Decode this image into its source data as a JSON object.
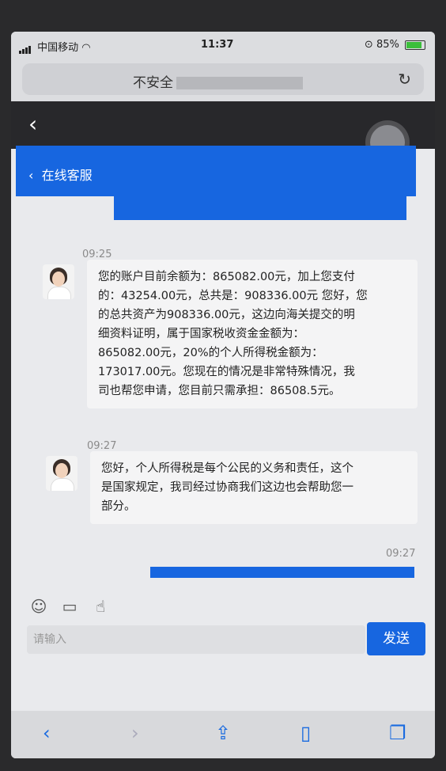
{
  "status_bar": {
    "carrier": "中国移动",
    "time": "11:37",
    "battery": "85%"
  },
  "address_bar": {
    "url_text": "不安全"
  },
  "header": {
    "title": "在线客服",
    "accent_color": "#1766e0"
  },
  "messages": [
    {
      "time": "09:25",
      "lines": [
        "您的账户目前余额为：865082.00元，加上您支付",
        "的：43254.00元，总共是：908336.00元 您好，您",
        "的总共资产为908336.00元，这边向海关提交的明",
        "细资料证明，属于国家税收资金金额为：",
        "865082.00元，20%的个人所得税金额为：",
        "173017.00元。您现在的情况是非常特殊情况，我",
        "司也帮您申请，您目前只需承担：86508.5元。"
      ]
    },
    {
      "time": "09:27",
      "lines": [
        "您好，个人所得税是每个公民的义务和责任，这个",
        "是国家规定，我司经过协商我们这边也会帮助您一",
        "部分。"
      ]
    },
    {
      "time": "09:27"
    }
  ],
  "composer": {
    "placeholder": "请输入",
    "send_label": "发送"
  },
  "icons": [
    "emoji-icon",
    "image-icon",
    "thumbs-up-icon",
    "share-icon",
    "bookmarks-icon",
    "tabs-icon"
  ]
}
